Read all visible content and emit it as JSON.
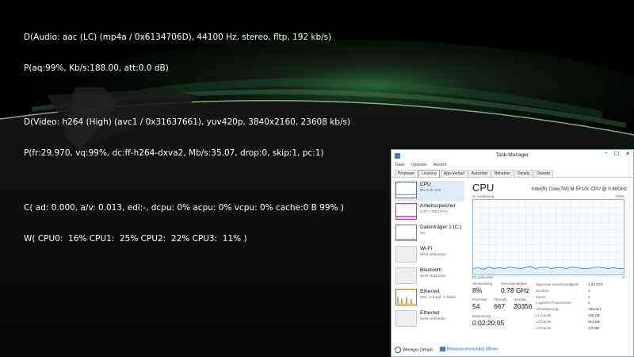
{
  "osd": {
    "lines": [
      "D(Audio: aac (LC) (mp4a / 0x6134706D), 44100 Hz, stereo, fltp, 192 kb/s)",
      "P(aq:99%, Kb/s:188.00, att:0.0 dB)",
      "D(Video: h264 (High) (avc1 / 0x31637661), yuv420p, 3840x2160, 23608 kb/s)",
      "P(fr:29.970, vq:99%, dc:ff-h264-dxva2, Mb/s:35.07, drop:0, skip:1, pc:1)",
      "C( ad: 0.000, a/v: 0.013, edl:-, dcpu: 0% acpu: 0% vcpu: 0% cache:0 B 99% )",
      "W( CPU0:  16% CPU1:  25% CPU2:  22% CPU3:  11% )"
    ]
  },
  "taskmanager": {
    "title": "Task-Manager",
    "window_controls": [
      "−",
      "☐",
      "✕"
    ],
    "menu": [
      "Datei",
      "Optionen",
      "Ansicht"
    ],
    "tabs": [
      "Prozesse",
      "Leistung",
      "App-Verlauf",
      "Autostart",
      "Benutzer",
      "Details",
      "Dienste"
    ],
    "active_tab": "Leistung",
    "resources": [
      {
        "name": "CPU",
        "sub": "8%  0,78 GHz",
        "color": "#1e7fd0",
        "active": true
      },
      {
        "name": "Arbeitsspeicher",
        "sub": "1,3/7,7 GB (17%)",
        "color": "#a23bb0",
        "active": false
      },
      {
        "name": "Datenträger 1 (C:)",
        "sub": "2%",
        "color": "#4aa33a",
        "active": false
      },
      {
        "name": "Wi-Fi",
        "sub": "Nicht verbunden",
        "color": "",
        "active": false
      },
      {
        "name": "Bluetooth",
        "sub": "Nicht verbunden",
        "color": "",
        "active": false
      },
      {
        "name": "Ethernet",
        "sub": "Ges.: 0 Empf.: 0 KBit/s",
        "color": "#c26a10",
        "active": false
      },
      {
        "name": "Ethernet",
        "sub": "Nicht verbunden",
        "color": "",
        "active": false
      }
    ],
    "cpu": {
      "heading": "CPU",
      "model": "Intel(R) Core(TM) M-5Y10c CPU @ 0.80GHz",
      "axis_top_left": "% Auslastung",
      "axis_top_right": "100%",
      "axis_bottom_left": "60 Sekunden",
      "axis_bottom_right": "0",
      "usage_history_percent": [
        8,
        9,
        7,
        10,
        8,
        9,
        8,
        10,
        9,
        8,
        9,
        11,
        8,
        9,
        10,
        8,
        9,
        9,
        8,
        10,
        9,
        8,
        8,
        9,
        10,
        9,
        8,
        9,
        8,
        8
      ],
      "stats": [
        {
          "label": "Verwendung",
          "value": "8%"
        },
        {
          "label": "Geschwindigkeit",
          "value": "0,78 GHz"
        },
        {
          "label": "Prozesse",
          "value": "54"
        },
        {
          "label": "Threads",
          "value": "667"
        },
        {
          "label": "Handles",
          "value": "20356"
        },
        {
          "label": "Betriebszeit",
          "value": "0:02:20:05"
        }
      ],
      "specs": [
        {
          "k": "Maximale Geschwindigkeit:",
          "v": "1,00 GHz"
        },
        {
          "k": "Sockets:",
          "v": "1"
        },
        {
          "k": "Kerne:",
          "v": "2"
        },
        {
          "k": "Logische Prozessoren:",
          "v": "4"
        },
        {
          "k": "Virtualisierung:",
          "v": "Aktiviert"
        },
        {
          "k": "L1-Cache:",
          "v": "128 KB"
        },
        {
          "k": "L2-Cache:",
          "v": "512 KB"
        },
        {
          "k": "L3-Cache:",
          "v": "4,0 MB"
        }
      ]
    },
    "footer": {
      "fewer_details": "Weniger Details",
      "resource_monitor": "Ressourcenmonitor öffnen"
    }
  }
}
